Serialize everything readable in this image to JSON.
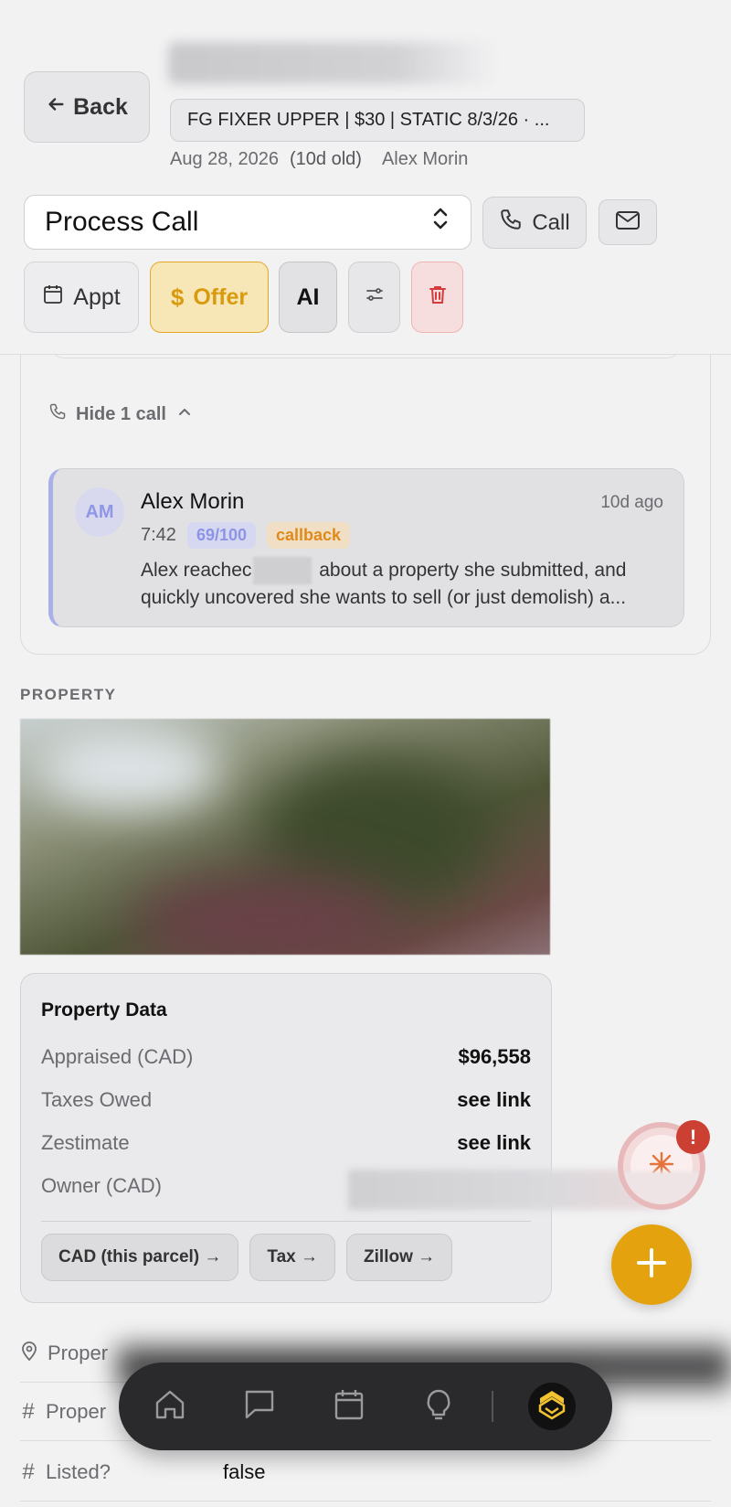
{
  "header": {
    "back_label": "Back",
    "campaign": "FG FIXER UPPER | $30 | STATIC 8/3/26 · ...",
    "date": "Aug 28, 2026",
    "age": "(10d old)",
    "assignee": "Alex Morin",
    "status_select": "Process Call",
    "call_label": "Call",
    "appt_label": "Appt",
    "offer_label": "Offer",
    "ai_label": "AI"
  },
  "calls": {
    "toggle_label": "Hide 1 call",
    "items": [
      {
        "initials": "AM",
        "name": "Alex Morin",
        "age": "10d ago",
        "duration": "7:42",
        "score": "69/100",
        "tag": "callback",
        "summary_before": "Alex reachec",
        "summary_after": " about a property she submitted, and quickly uncovered she wants to sell (or just demolish) a..."
      }
    ]
  },
  "property": {
    "section_label": "PROPERTY",
    "card_title": "Property Data",
    "rows": [
      {
        "label": "Appraised (CAD)",
        "value": "$96,558"
      },
      {
        "label": "Taxes Owed",
        "value": "see link"
      },
      {
        "label": "Zestimate",
        "value": "see link"
      },
      {
        "label": "Owner (CAD)",
        "value": ""
      }
    ],
    "links": [
      "CAD (this parcel) →",
      "Tax →",
      "Zillow →"
    ],
    "fields": [
      {
        "label": "Proper",
        "value": "",
        "icon": "map-pin-icon"
      },
      {
        "label": "Proper",
        "value": "",
        "icon": "hash-icon"
      },
      {
        "label": "Listed?",
        "value": "false",
        "icon": "hash-icon"
      }
    ]
  },
  "fab": {
    "alert_badge": "!"
  },
  "colors": {
    "accent": "#e4a30e",
    "offer_text": "#d99a0e",
    "score": "#8d94e6",
    "callback": "#e08a1a",
    "danger": "#cc3f33"
  }
}
